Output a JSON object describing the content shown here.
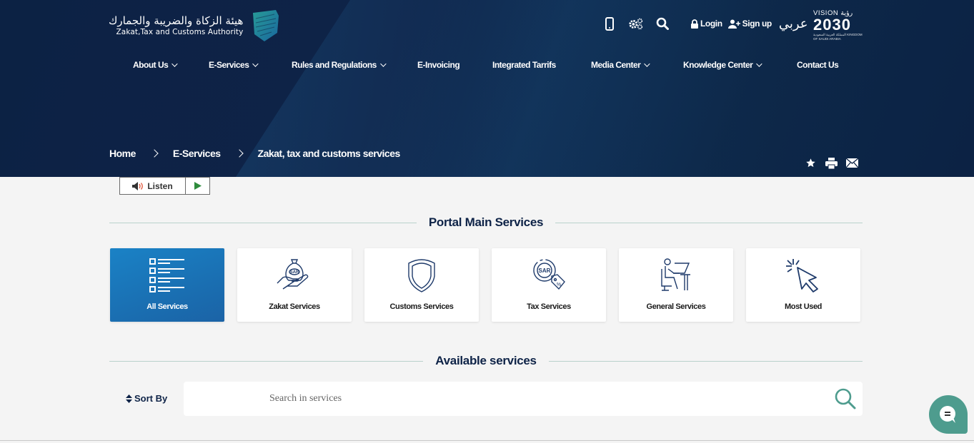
{
  "header": {
    "logo_ar": "هيئة الزكاة والضريبة والجمارك",
    "logo_en": "Zakat,Tax and Customs Authority",
    "topbar": {
      "login": "Login",
      "signup": "Sign up",
      "language": "عربي",
      "icons": [
        "mobile-icon",
        "settings-icon",
        "search-icon"
      ]
    },
    "vision": {
      "line1": "VISION رؤية",
      "line2": "2030",
      "line3": "المملكة العربية السعودية KINGDOM OF SAUDI ARABIA"
    }
  },
  "nav": [
    {
      "label": "About Us",
      "dropdown": true
    },
    {
      "label": "E-Services",
      "dropdown": true
    },
    {
      "label": "Rules and Regulations",
      "dropdown": true
    },
    {
      "label": "E-Invoicing",
      "dropdown": false
    },
    {
      "label": "Integrated Tarrifs",
      "dropdown": false
    },
    {
      "label": "Media Center",
      "dropdown": true
    },
    {
      "label": "Knowledge Center",
      "dropdown": true
    },
    {
      "label": "Contact Us",
      "dropdown": false
    }
  ],
  "breadcrumb": [
    "Home",
    "E-Services",
    "Zakat, tax and customs services"
  ],
  "share_icons": [
    "star-icon",
    "print-icon",
    "mail-icon"
  ],
  "listen": {
    "label": "Listen"
  },
  "portal": {
    "title": "Portal Main Services",
    "cards": [
      {
        "label": "All Services",
        "icon": "list-icon",
        "active": true
      },
      {
        "label": "Zakat Services",
        "icon": "money-bag-hand-icon",
        "active": false
      },
      {
        "label": "Customs Services",
        "icon": "shield-icon",
        "active": false
      },
      {
        "label": "Tax Services",
        "icon": "sar-tag-icon",
        "active": false
      },
      {
        "label": "General Services",
        "icon": "person-desk-icon",
        "active": false
      },
      {
        "label": "Most Used",
        "icon": "cursor-click-icon",
        "active": false
      }
    ]
  },
  "available": {
    "title": "Available services",
    "sort_label": "Sort By",
    "search_placeholder": "Search in services"
  },
  "colors": {
    "header_bg": "#0c2244",
    "accent_blue": "#1a77bd",
    "accent_teal": "#4e9c8e",
    "text_dark": "#0e2347"
  }
}
